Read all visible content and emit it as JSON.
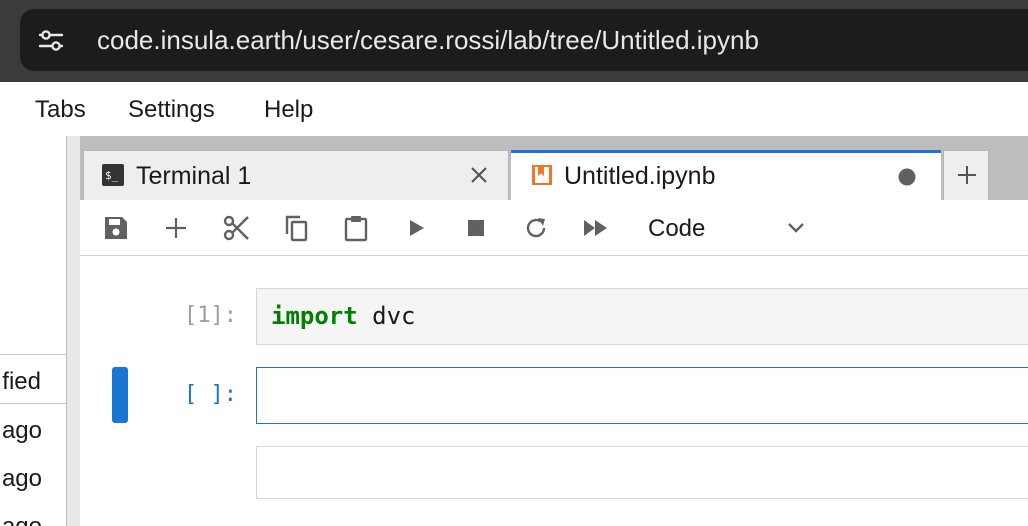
{
  "browser": {
    "url": "code.insula.earth/user/cesare.rossi/lab/tree/Untitled.ipynb",
    "settings_icon": "sliders-icon"
  },
  "menu": {
    "items": [
      "Tabs",
      "Settings",
      "Help"
    ]
  },
  "file_browser": {
    "column_header": "fied",
    "rows": [
      "ago",
      "ago",
      "ago"
    ]
  },
  "tabs": [
    {
      "label": "Terminal 1",
      "icon": "terminal-icon",
      "action_icon": "close-icon",
      "active": false
    },
    {
      "label": "Untitled.ipynb",
      "icon": "notebook-icon",
      "action_icon": "unsaved-dot-icon",
      "active": true
    }
  ],
  "add_tab_icon": "plus-icon",
  "toolbar": {
    "buttons": [
      "save-icon",
      "add-cell-icon",
      "cut-icon",
      "copy-icon",
      "paste-icon",
      "run-icon",
      "stop-icon",
      "restart-icon",
      "run-all-icon"
    ],
    "cell_type": "Code"
  },
  "cells": [
    {
      "prompt": "[1]:",
      "code_keyword": "import",
      "code_rest": " dvc"
    },
    {
      "prompt": "[ ]:",
      "code": ""
    },
    {
      "prompt": "",
      "code": ""
    }
  ],
  "colors": {
    "accent": "#1976d2",
    "keyword": "#008000",
    "notebook_icon": "#f37626"
  }
}
